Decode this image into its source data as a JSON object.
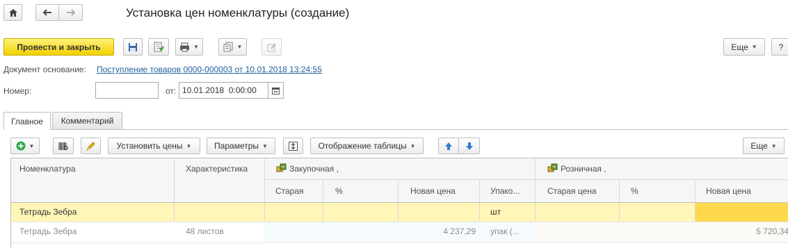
{
  "window": {
    "title": "Установка цен номенклатуры (создание)"
  },
  "toolbar": {
    "post_close_label": "Провести и закрыть",
    "more_label": "Еще",
    "help_label": "?"
  },
  "header": {
    "base_doc_label": "Документ основание:",
    "base_doc_link": "Поступление товаров 0000-000003 от 10.01.2018 13:24:55",
    "number_label": "Номер:",
    "number_value": "",
    "date_from_label": "от:",
    "date_value": "10.01.2018  0:00:00"
  },
  "tabs": [
    {
      "label": "Главное",
      "active": true
    },
    {
      "label": "Комментарий",
      "active": false
    }
  ],
  "table_toolbar": {
    "set_prices_label": "Установить цены",
    "params_label": "Параметры",
    "display_label": "Отображение таблицы",
    "more_label": "Еще"
  },
  "table": {
    "columns": {
      "item": "Номенклатура",
      "characteristic": "Характеристика",
      "purchase_group": "Закупочная ,",
      "retail_group": "Розничная ,",
      "p_old": "Старая",
      "p_percent": "%",
      "p_new": "Новая цена",
      "p_unit": "Упако...",
      "r_old": "Старая цена",
      "r_percent": "%",
      "r_new": "Новая цена"
    },
    "rows": [
      {
        "item": "Тетрадь Зебра",
        "characteristic": "",
        "p_old": "",
        "p_percent": "",
        "p_new": "",
        "p_unit": "шт",
        "r_old": "",
        "r_percent": "",
        "r_new": ""
      },
      {
        "item": "Тетрадь Зебра",
        "characteristic": "48 листов",
        "p_old": "",
        "p_percent": "",
        "p_new": "4 237,29",
        "p_unit": "упак (...",
        "r_old": "",
        "r_percent": "",
        "r_new": "5 720,34"
      }
    ]
  },
  "colors": {
    "primary_button": "#f2d000",
    "selected_row": "#fff6b8",
    "active_cell": "#ffd84d",
    "link": "#1f5f9f"
  }
}
